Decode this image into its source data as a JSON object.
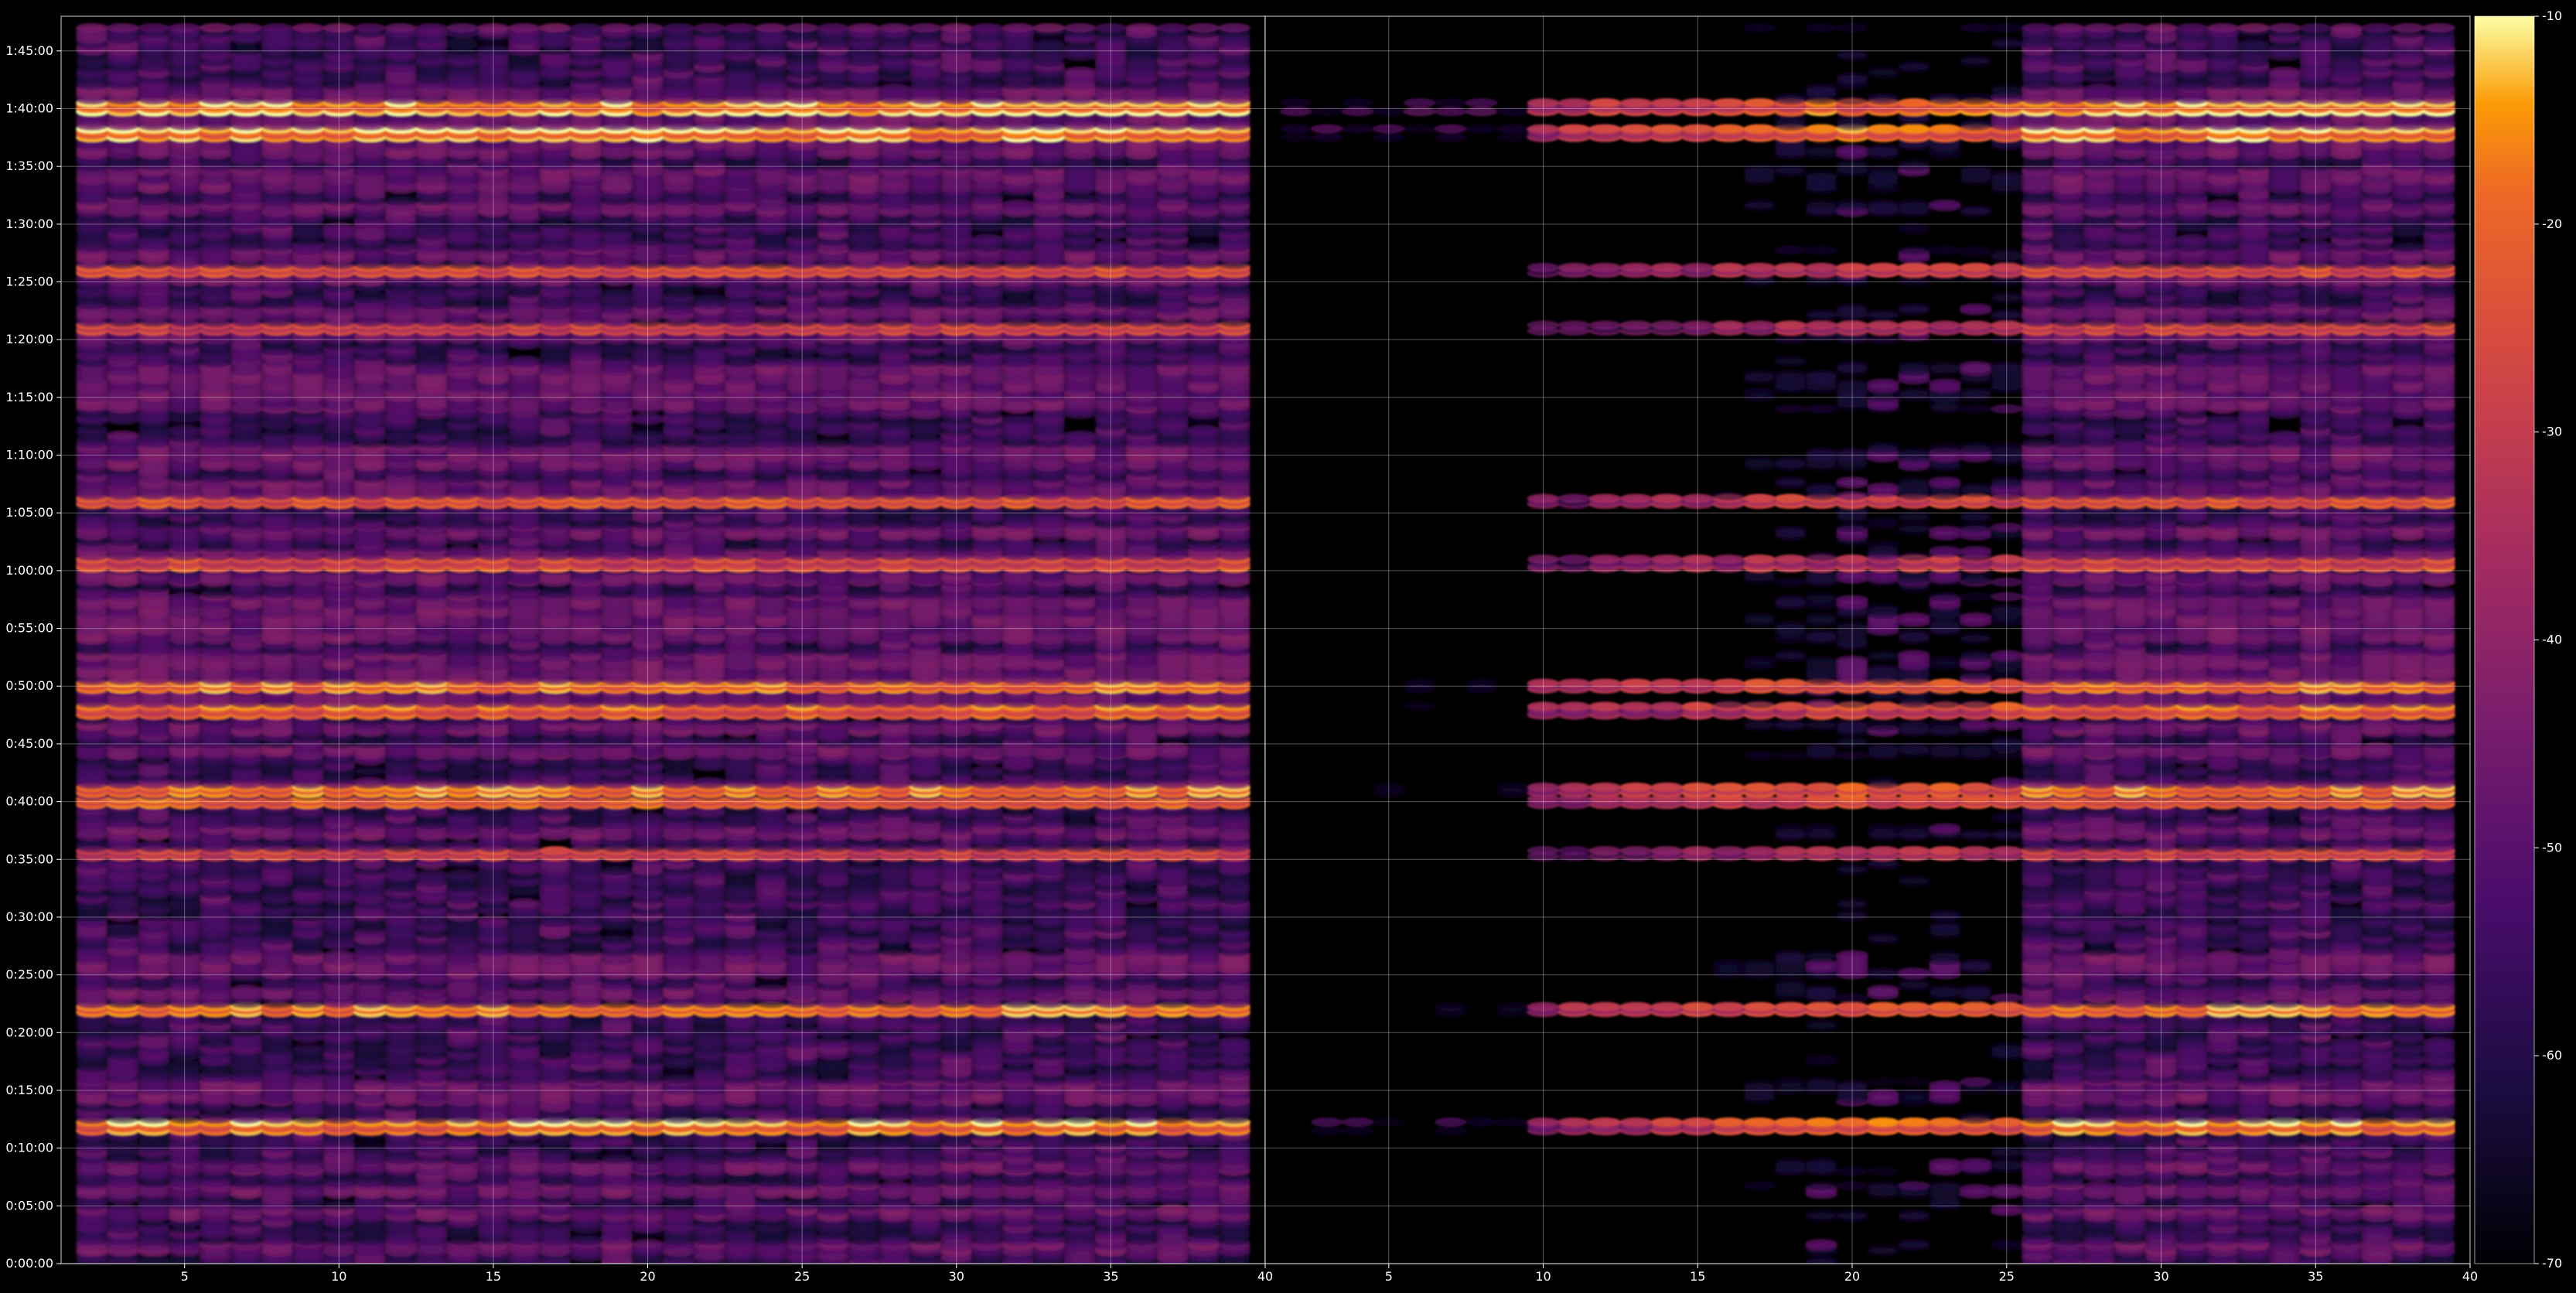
{
  "chart_data": [
    {
      "type": "heatmap",
      "panel": "left",
      "x_ticks": [
        "5",
        "10",
        "15",
        "20",
        "25",
        "30",
        "35"
      ],
      "xlim": [
        1,
        40
      ],
      "y_ticks": [
        "0:00:00",
        "0:05:00",
        "0:10:00",
        "0:15:00",
        "0:20:00",
        "0:25:00",
        "0:30:00",
        "0:35:00",
        "0:40:00",
        "0:45:00",
        "0:50:00",
        "0:55:00",
        "1:00:00",
        "1:05:00",
        "1:10:00",
        "1:15:00",
        "1:20:00",
        "1:25:00",
        "1:30:00",
        "1:35:00",
        "1:40:00",
        "1:45:00"
      ],
      "ylim": [
        "0:00:00",
        "1:48:00"
      ],
      "columns_x_range": [
        2,
        39
      ],
      "row_step_seconds": 15,
      "value_range": [
        -70,
        -10
      ],
      "grid": true,
      "dominant_rows": [
        {
          "time": "1:40:10",
          "level": -25
        },
        {
          "time": "1:37:50",
          "level": -25
        },
        {
          "time": "1:26:00",
          "level": -32
        },
        {
          "time": "1:21:00",
          "level": -35
        },
        {
          "time": "1:06:00",
          "level": -30
        },
        {
          "time": "1:00:40",
          "level": -36
        },
        {
          "time": "0:50:00",
          "level": -25
        },
        {
          "time": "0:47:50",
          "level": -32
        },
        {
          "time": "0:41:00",
          "level": -24
        },
        {
          "time": "0:40:00",
          "level": -28
        },
        {
          "time": "0:35:30",
          "level": -35
        },
        {
          "time": "0:22:00",
          "level": -24
        },
        {
          "time": "0:11:50",
          "level": -28
        }
      ]
    },
    {
      "type": "heatmap",
      "panel": "right",
      "x_ticks": [
        "40",
        "5",
        "10",
        "15",
        "20",
        "25",
        "30",
        "35",
        "40"
      ],
      "xlim": [
        1,
        40
      ],
      "y_ticks": [],
      "columns_x_range": [
        2,
        39
      ],
      "value_range": [
        -70,
        -10
      ],
      "grid": true,
      "note_visible_onset_x": 10
    }
  ],
  "colorbar": {
    "colormap": "inferno",
    "ticks": [
      "-10",
      "-20",
      "-30",
      "-40",
      "-50",
      "-60",
      "-70"
    ],
    "range": [
      -70,
      -10
    ]
  }
}
